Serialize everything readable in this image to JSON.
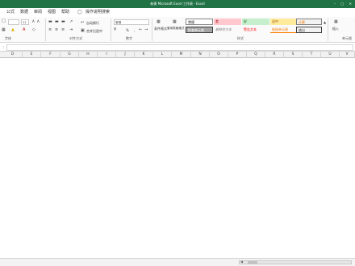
{
  "window": {
    "title": "新建 Microsoft Excel 工作表 - Excel"
  },
  "menu": {
    "items": [
      "公式",
      "数据",
      "审阅",
      "视图",
      "帮助"
    ],
    "search_hint": "操作说明搜索"
  },
  "ribbon": {
    "font": {
      "size": "11",
      "increase": "A",
      "decrease": "A",
      "group_label": "字体"
    },
    "alignment": {
      "wrap_text": "自动换行",
      "merge_center": "合并后居中",
      "group_label": "对齐方式"
    },
    "number": {
      "format": "常规",
      "percent": "%",
      "comma": ",",
      "group_label": "数字"
    },
    "styles": {
      "conditional": "条件格式",
      "table_format": "套用表格格式",
      "cells": [
        "常规",
        "差",
        "好",
        "适中",
        "计算",
        "检查单元格",
        "解释性文本",
        "警告文本",
        "链接单元格",
        "输出"
      ],
      "group_label": "样式"
    },
    "cells_group": {
      "insert": "插入",
      "group_label": "单元格"
    }
  },
  "sheet": {
    "columns": [
      "D",
      "E",
      "F",
      "G",
      "H",
      "I",
      "J",
      "K",
      "L",
      "M",
      "N",
      "O",
      "P",
      "Q",
      "R",
      "S",
      "T",
      "U",
      "V"
    ]
  }
}
